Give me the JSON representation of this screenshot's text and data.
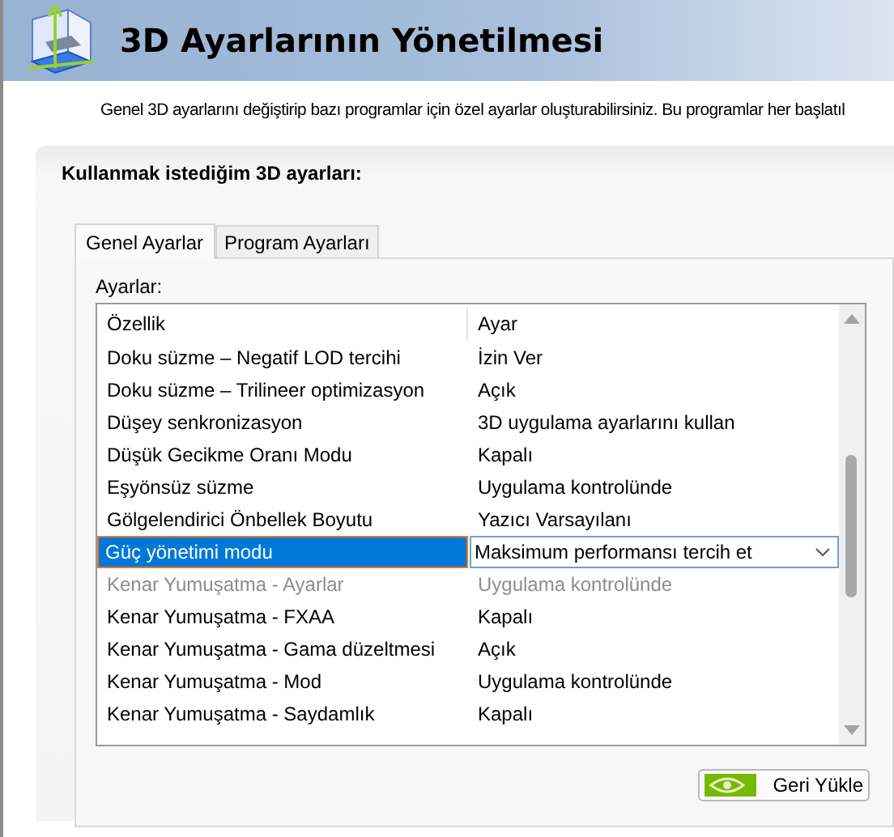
{
  "header": {
    "title": "3D Ayarlarının Yönetilmesi"
  },
  "description": "Genel 3D ayarlarını değiştirip bazı programlar için özel ayarlar oluşturabilirsiniz. Bu programlar her başlatıl",
  "panel": {
    "title": "Kullanmak istediğim 3D ayarları:",
    "tabs": [
      {
        "label": "Genel Ayarlar",
        "selected": true
      },
      {
        "label": "Program Ayarları",
        "selected": false
      }
    ],
    "list_label": "Ayarlar:",
    "columns": [
      "Özellik",
      "Ayar"
    ],
    "rows": [
      {
        "feature": "Doku süzme – Negatif LOD tercihi",
        "value": "İzin Ver",
        "selected": false,
        "disabled": false
      },
      {
        "feature": "Doku süzme – Trilineer optimizasyon",
        "value": "Açık",
        "selected": false,
        "disabled": false
      },
      {
        "feature": "Düşey senkronizasyon",
        "value": "3D uygulama ayarlarını kullan",
        "selected": false,
        "disabled": false
      },
      {
        "feature": "Düşük Gecikme Oranı Modu",
        "value": "Kapalı",
        "selected": false,
        "disabled": false
      },
      {
        "feature": "Eşyönsüz süzme",
        "value": "Uygulama kontrolünde",
        "selected": false,
        "disabled": false
      },
      {
        "feature": "Gölgelendirici Önbellek Boyutu",
        "value": "Yazıcı Varsayılanı",
        "selected": false,
        "disabled": false
      },
      {
        "feature": "Güç yönetimi modu",
        "value": "Maksimum performansı tercih et",
        "selected": true,
        "disabled": false
      },
      {
        "feature": "Kenar Yumuşatma - Ayarlar",
        "value": "Uygulama kontrolünde",
        "selected": false,
        "disabled": true
      },
      {
        "feature": "Kenar Yumuşatma - FXAA",
        "value": "Kapalı",
        "selected": false,
        "disabled": false
      },
      {
        "feature": "Kenar Yumuşatma - Gama düzeltmesi",
        "value": "Açık",
        "selected": false,
        "disabled": false
      },
      {
        "feature": "Kenar Yumuşatma - Mod",
        "value": "Uygulama kontrolünde",
        "selected": false,
        "disabled": false
      },
      {
        "feature": "Kenar Yumuşatma - Saydamlık",
        "value": "Kapalı",
        "selected": false,
        "disabled": false
      }
    ],
    "restore_button": "Geri Yükle"
  }
}
